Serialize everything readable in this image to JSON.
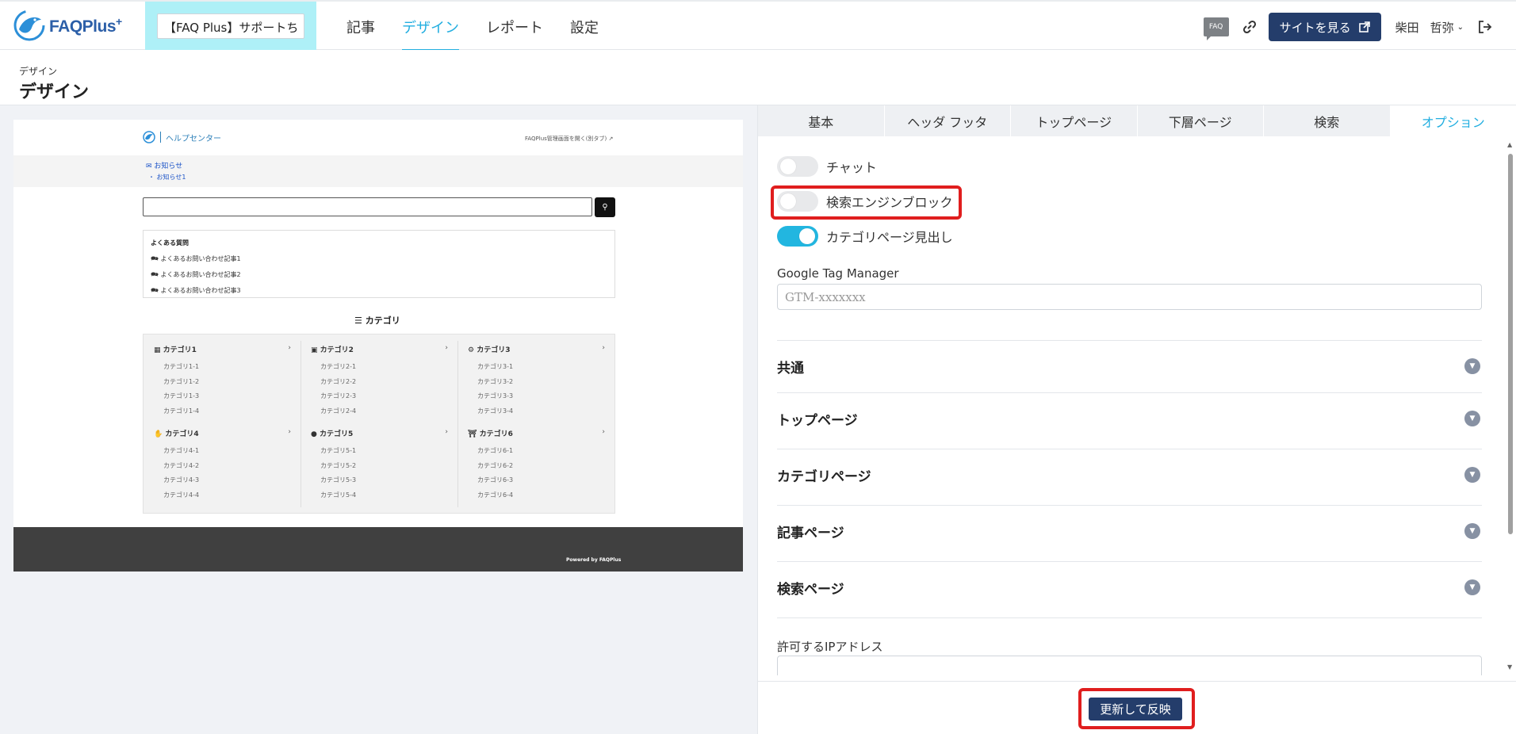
{
  "header": {
    "logo_text": "FAQPlus",
    "logo_plus": "+",
    "site_select_value": "【FAQ Plus】サポートち",
    "nav": [
      {
        "label": "記事",
        "active": false
      },
      {
        "label": "デザイン",
        "active": true
      },
      {
        "label": "レポート",
        "active": false
      },
      {
        "label": "設定",
        "active": false
      }
    ],
    "faq_badge": "FAQ",
    "site_button": "サイトを見る",
    "user_last": "柴田",
    "user_first": "哲弥"
  },
  "page": {
    "breadcrumb": "デザイン",
    "title": "デザイン"
  },
  "preview": {
    "logo_text": "ヘルプセンター",
    "admin_link": "FAQPlus管理画面を開く(別タブ)",
    "notice_title": "お知らせ",
    "notice_item": "・ お知らせ1",
    "faq_title": "よくある質問",
    "faq_items": [
      "よくあるお問い合わせ記事1",
      "よくあるお問い合わせ記事2",
      "よくあるお問い合わせ記事3"
    ],
    "category_heading": "カテゴリ",
    "categories": [
      {
        "name": "カテゴリ1",
        "subs": [
          "カテゴリ1-1",
          "カテゴリ1-2",
          "カテゴリ1-3",
          "カテゴリ1-4"
        ]
      },
      {
        "name": "カテゴリ2",
        "subs": [
          "カテゴリ2-1",
          "カテゴリ2-2",
          "カテゴリ2-3",
          "カテゴリ2-4"
        ]
      },
      {
        "name": "カテゴリ3",
        "subs": [
          "カテゴリ3-1",
          "カテゴリ3-2",
          "カテゴリ3-3",
          "カテゴリ3-4"
        ]
      },
      {
        "name": "カテゴリ4",
        "subs": [
          "カテゴリ4-1",
          "カテゴリ4-2",
          "カテゴリ4-3",
          "カテゴリ4-4"
        ]
      },
      {
        "name": "カテゴリ5",
        "subs": [
          "カテゴリ5-1",
          "カテゴリ5-2",
          "カテゴリ5-3",
          "カテゴリ5-4"
        ]
      },
      {
        "name": "カテゴリ6",
        "subs": [
          "カテゴリ6-1",
          "カテゴリ6-2",
          "カテゴリ6-3",
          "カテゴリ6-4"
        ]
      }
    ],
    "powered_by": "Powered by FAQPlus"
  },
  "settings": {
    "tabs": [
      {
        "label": "基本",
        "active": false
      },
      {
        "label": "ヘッダ フッタ",
        "active": false
      },
      {
        "label": "トップページ",
        "active": false
      },
      {
        "label": "下層ページ",
        "active": false
      },
      {
        "label": "検索",
        "active": false
      },
      {
        "label": "オプション",
        "active": true
      }
    ],
    "toggles": [
      {
        "label": "チャット",
        "on": false
      },
      {
        "label": "検索エンジンブロック",
        "on": false
      },
      {
        "label": "カテゴリページ見出し",
        "on": true
      }
    ],
    "gtm_label": "Google Tag Manager",
    "gtm_placeholder": "GTM-xxxxxxx",
    "accordions": [
      "共通",
      "トップページ",
      "カテゴリページ",
      "記事ページ",
      "検索ページ"
    ],
    "ip_label": "許可するIPアドレス",
    "update_button": "更新して反映"
  },
  "colors": {
    "accent": "#22aee0",
    "navy": "#243d6b",
    "highlight": "#e01e1e"
  }
}
